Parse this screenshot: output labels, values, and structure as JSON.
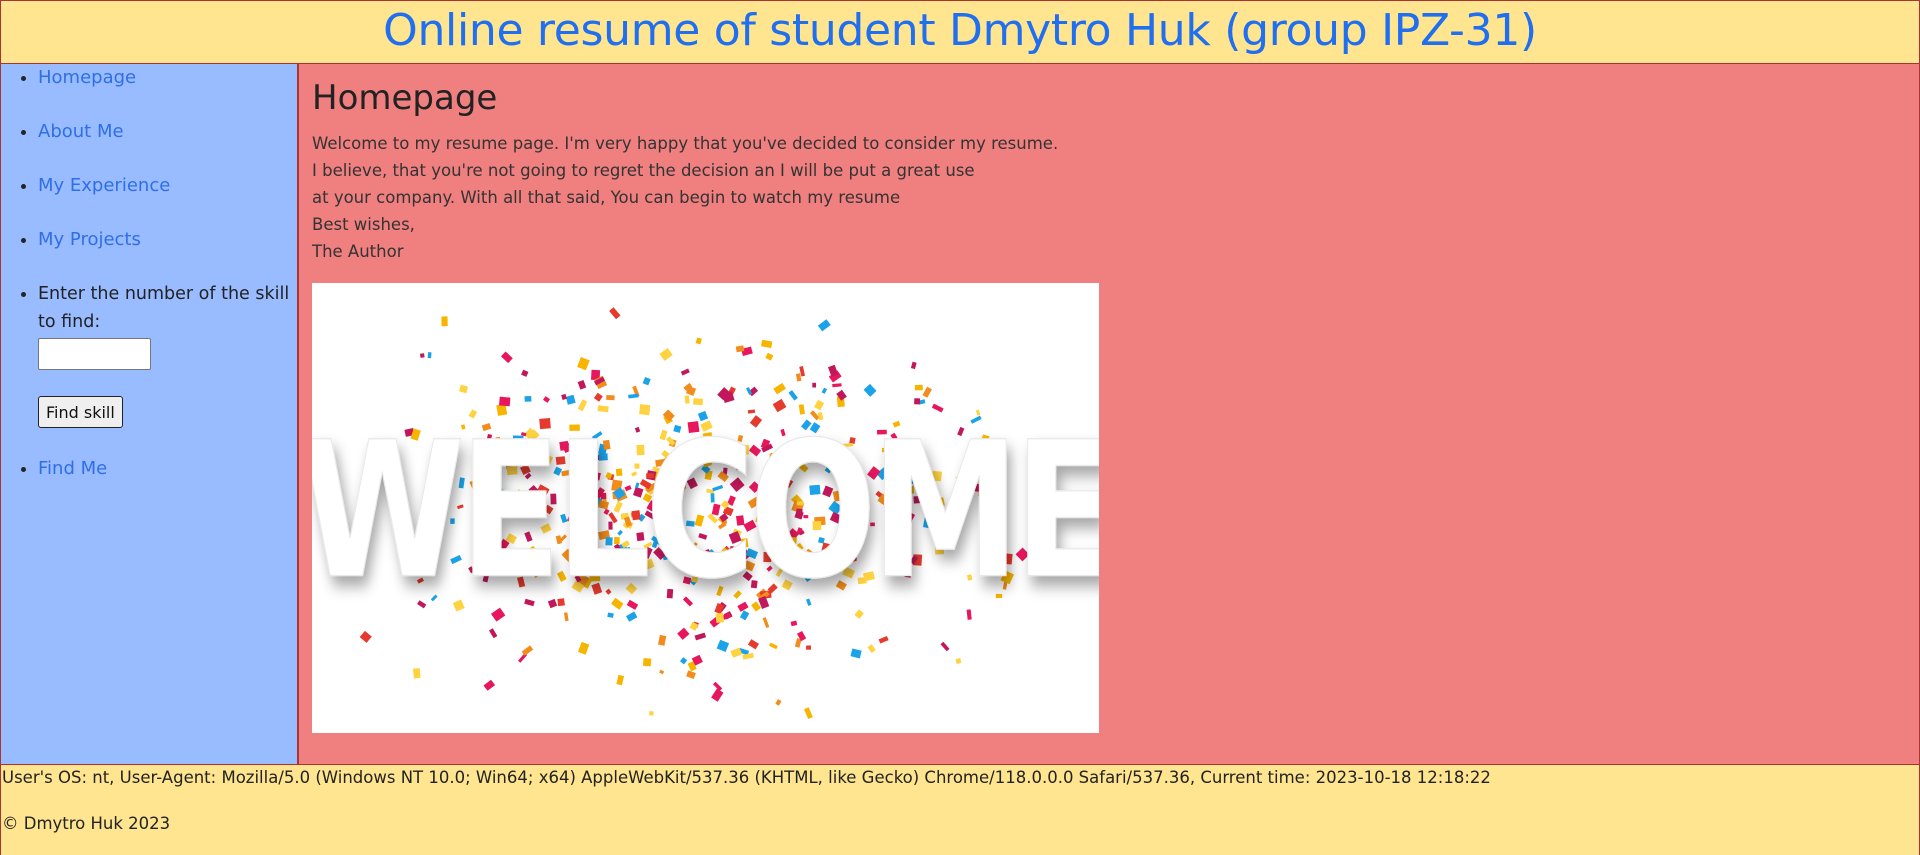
{
  "header": {
    "title": "Online resume of student Dmytro Huk (group IPZ-31)"
  },
  "sidebar": {
    "items": [
      {
        "label": "Homepage"
      },
      {
        "label": "About Me"
      },
      {
        "label": "My Experience"
      },
      {
        "label": "My Projects"
      }
    ],
    "skill_prompt": "Enter the number of the skill to find:",
    "skill_input_value": "",
    "find_button": "Find skill",
    "find_me": "Find Me"
  },
  "main": {
    "heading": "Homepage",
    "lines": [
      "Welcome to my resume page. I'm very happy that you've decided to consider my resume.",
      "I believe, that you're not going to regret the decision an I will be put a great use",
      "at your company. With all that said, You can begin to watch my resume",
      "Best wishes,",
      "The Author"
    ],
    "image_text": "WELCOME",
    "image_icon": "welcome-confetti-image"
  },
  "footer": {
    "user_agent": "User's OS: nt, User-Agent: Mozilla/5.0 (Windows NT 10.0; Win64; x64) AppleWebKit/537.36 (KHTML, like Gecko) Chrome/118.0.0.0 Safari/537.36, Current time: 2023-10-18 12:18:22",
    "copyright": "© Dmytro Huk 2023"
  },
  "colors": {
    "header_bg": "#ffe58f",
    "sidebar_bg": "#99bbff",
    "main_bg": "#f07f7f",
    "title_color": "#1f6ff0",
    "link_color": "#2f6fe6",
    "border": "#aa3333"
  }
}
